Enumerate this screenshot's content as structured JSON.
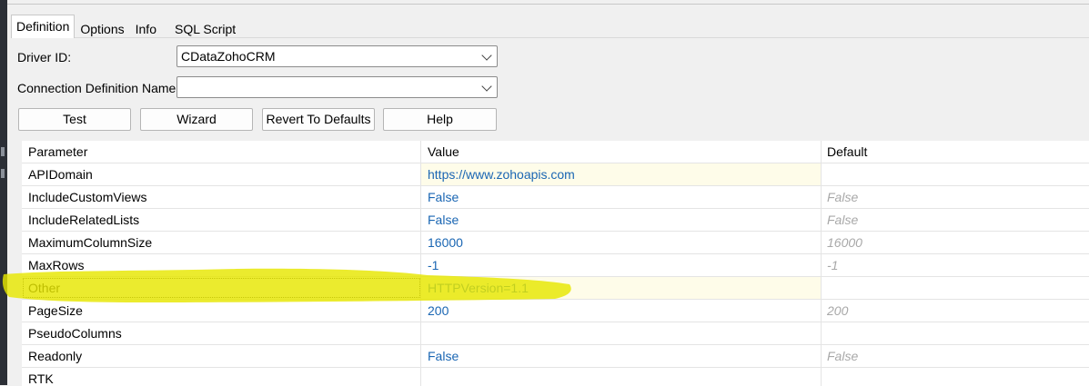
{
  "tabs": [
    {
      "label": "Definition"
    },
    {
      "label": "Options"
    },
    {
      "label": "Info"
    },
    {
      "label": "SQL Script"
    }
  ],
  "driver": {
    "label": "Driver ID:",
    "value": "CDataZohoCRM"
  },
  "connection": {
    "label": "Connection Definition Name:",
    "value": ""
  },
  "buttons": {
    "test": "Test",
    "wizard": "Wizard",
    "revert": "Revert To Defaults",
    "help": "Help"
  },
  "grid": {
    "columns": [
      "Parameter",
      "Value",
      "Default"
    ],
    "rows": [
      {
        "parameter": "APIDomain",
        "value": "https://www.zohoapis.com",
        "default": ""
      },
      {
        "parameter": "IncludeCustomViews",
        "value": "False",
        "default": "False"
      },
      {
        "parameter": "IncludeRelatedLists",
        "value": "False",
        "default": "False"
      },
      {
        "parameter": "MaximumColumnSize",
        "value": "16000",
        "default": "16000"
      },
      {
        "parameter": "MaxRows",
        "value": "-1",
        "default": "-1"
      },
      {
        "parameter": "Other",
        "value": "HTTPVersion=1.1",
        "default": ""
      },
      {
        "parameter": "PageSize",
        "value": "200",
        "default": "200"
      },
      {
        "parameter": "PseudoColumns",
        "value": "",
        "default": ""
      },
      {
        "parameter": "Readonly",
        "value": "False",
        "default": "False"
      },
      {
        "parameter": "RTK",
        "value": "",
        "default": ""
      }
    ]
  },
  "colors": {
    "value_text": "#1a66b3",
    "default_text": "#a8a8a8",
    "highlighter": "#e6e600"
  }
}
